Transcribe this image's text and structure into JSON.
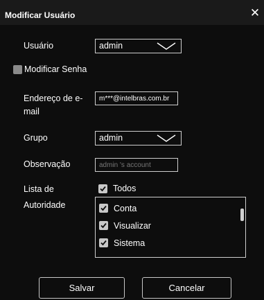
{
  "dialog": {
    "title": "Modificar Usuário"
  },
  "form": {
    "user": {
      "label": "Usuário",
      "value": "admin"
    },
    "change_password": {
      "label": "Modificar Senha",
      "checked": false
    },
    "email": {
      "label_line1": "Endereço de e-",
      "label_line2": "mail",
      "value": "m***@intelbras.com.br"
    },
    "group": {
      "label": "Grupo",
      "value": "admin"
    },
    "note": {
      "label": "Observação",
      "placeholder": "admin 's account"
    },
    "authority": {
      "label_line1": "Lista de",
      "label_line2": "Autoridade",
      "all_label": "Todos",
      "items": [
        {
          "label": "Conta",
          "checked": true
        },
        {
          "label": "Visualizar",
          "checked": true
        },
        {
          "label": "Sistema",
          "checked": true
        }
      ]
    }
  },
  "buttons": {
    "save": "Salvar",
    "cancel": "Cancelar"
  },
  "colors": {
    "background": "#0d0d0d",
    "checkbox": "#c8c8c8",
    "border": "#cfcfcf"
  }
}
